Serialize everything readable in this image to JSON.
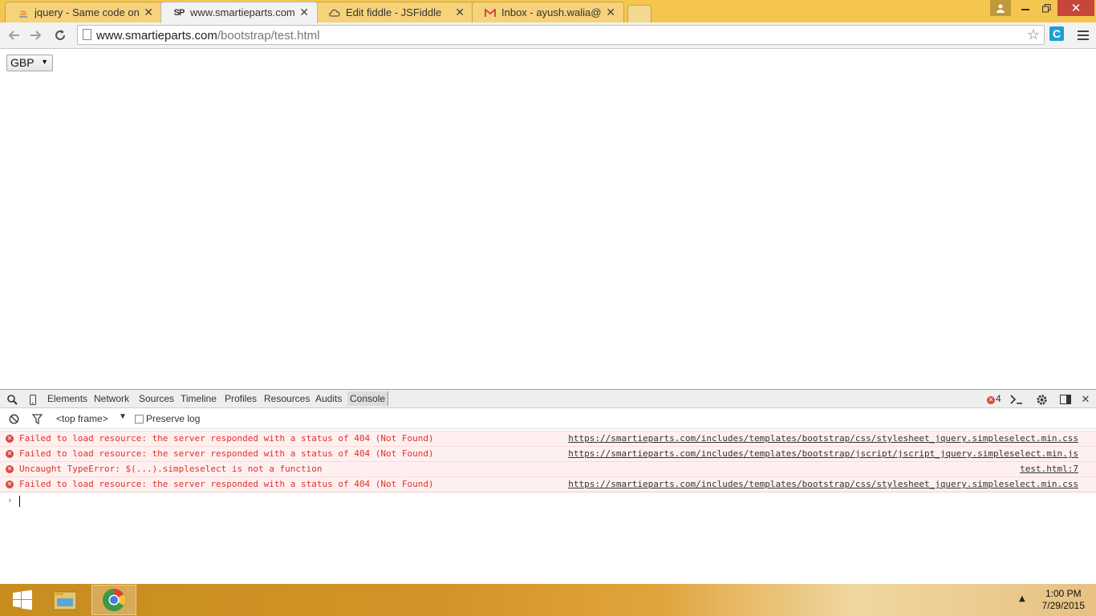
{
  "browser": {
    "tabs": [
      {
        "title": "jquery - Same code on jsfi",
        "favicon": "stackoverflow-icon",
        "active": false
      },
      {
        "title": "www.smartieparts.com/bo",
        "favicon": "SP",
        "active": true
      },
      {
        "title": "Edit fiddle - JSFiddle",
        "favicon": "jsfiddle-icon",
        "active": false
      },
      {
        "title": "Inbox - ayush.walia@aspi",
        "favicon": "gmail-icon",
        "active": false
      }
    ],
    "close_glyph": "✕",
    "url_host": "www.smartieparts.com",
    "url_path": "/bootstrap/test.html",
    "extension_letter": "C"
  },
  "page": {
    "currency_select": {
      "value": "GBP",
      "arrow": "▼"
    }
  },
  "devtools": {
    "tabs": [
      "Elements",
      "Network",
      "Sources",
      "Timeline",
      "Profiles",
      "Resources",
      "Audits",
      "Console"
    ],
    "active_tab": "Console",
    "error_count": "4",
    "filter": {
      "frame": "<top frame>",
      "frame_arrow": "▼",
      "preserve_log": "Preserve log"
    },
    "messages": [
      {
        "text": "Failed to load resource: the server responded with a status of 404 (Not Found)",
        "source": "https://smartieparts.com/includes/templates/bootstrap/css/stylesheet_jquery.simpleselect.min.css"
      },
      {
        "text": "Failed to load resource: the server responded with a status of 404 (Not Found)",
        "source": "https://smartieparts.com/includes/templates/bootstrap/jscript/jscript_jquery.simpleselect.min.js"
      },
      {
        "text": "Uncaught TypeError: $(...).simpleselect is not a function",
        "source": "test.html:7"
      },
      {
        "text": "Failed to load resource: the server responded with a status of 404 (Not Found)",
        "source": "https://smartieparts.com/includes/templates/bootstrap/css/stylesheet_jquery.simpleselect.min.css"
      }
    ],
    "error_glyph": "✕",
    "prompt_glyph": "›"
  },
  "taskbar": {
    "time": "1:00 PM",
    "date": "7/29/2015",
    "tray_arrow": "▲"
  },
  "colors": {
    "tabstrip": "#f4c64f",
    "error_text": "#e0312a",
    "error_row_bg": "#fff0f0",
    "close_button": "#c7463b"
  }
}
